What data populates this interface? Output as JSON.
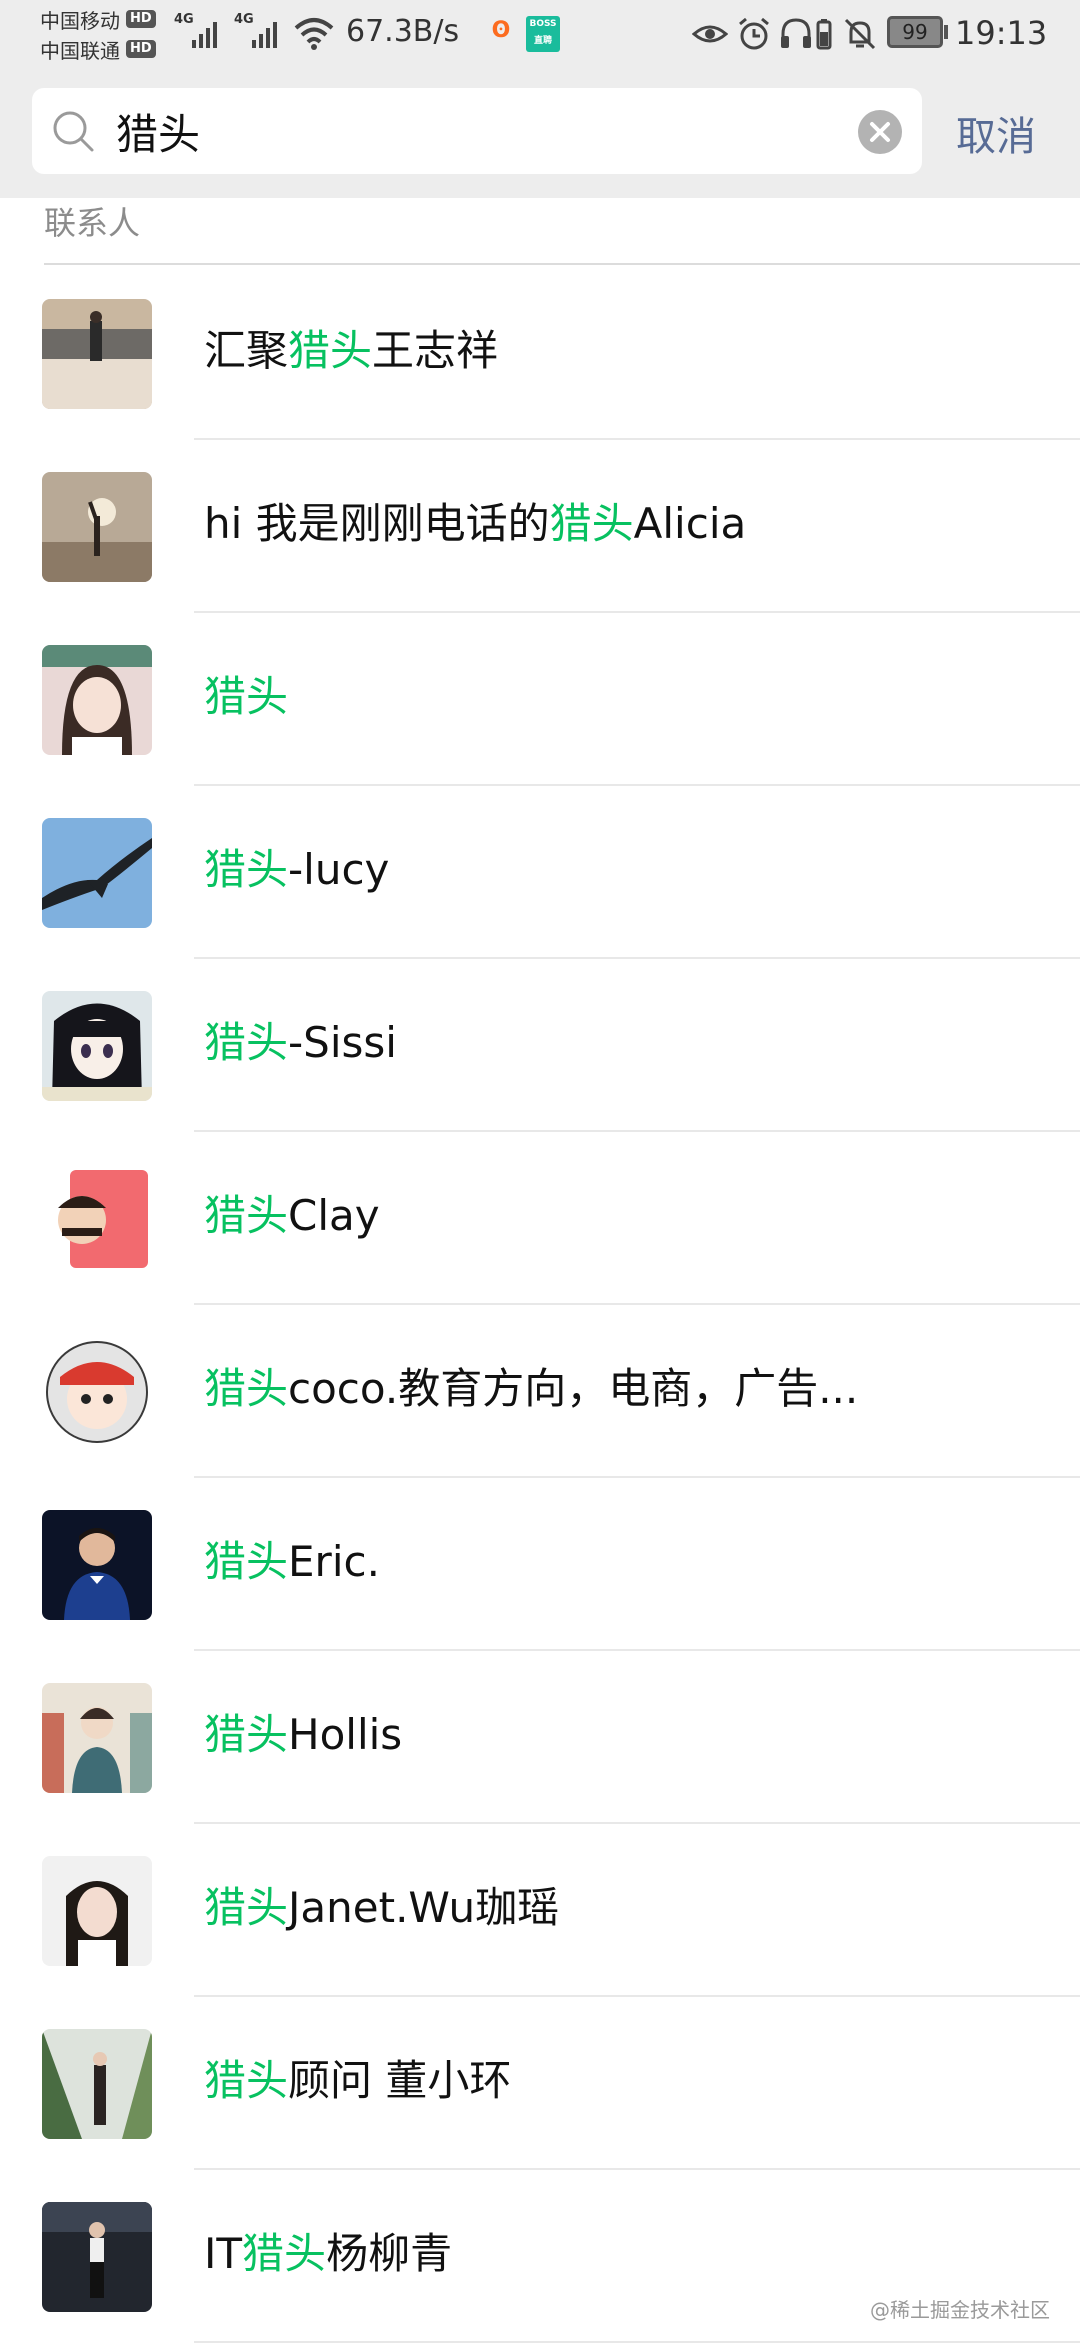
{
  "status_bar": {
    "carrier_1": "中国移动",
    "carrier_2": "中国联通",
    "hd_label": "HD",
    "network_type": "4G",
    "net_speed": "67.3B/s",
    "boss_label_top": "BOSS",
    "boss_label_bottom": "直聘",
    "battery_level": "99",
    "time": "19:13"
  },
  "search": {
    "query": "猎头",
    "cancel_label": "取消"
  },
  "section": {
    "title": "联系人"
  },
  "contacts": [
    {
      "pre": "汇聚",
      "hl": "猎头",
      "post": "王志祥"
    },
    {
      "pre": "hi 我是刚刚电话的",
      "hl": "猎头",
      "post": "Alicia"
    },
    {
      "pre": "",
      "hl": "猎头",
      "post": ""
    },
    {
      "pre": "",
      "hl": "猎头",
      "post": "-lucy"
    },
    {
      "pre": "",
      "hl": "猎头",
      "post": "-Sissi"
    },
    {
      "pre": "",
      "hl": "猎头",
      "post": "Clay"
    },
    {
      "pre": "",
      "hl": "猎头",
      "post": "coco.教育方向，电商，广告..."
    },
    {
      "pre": "",
      "hl": "猎头",
      "post": "Eric."
    },
    {
      "pre": "",
      "hl": "猎头",
      "post": "Hollis"
    },
    {
      "pre": "",
      "hl": "猎头",
      "post": "Janet.Wu珈瑶"
    },
    {
      "pre": "",
      "hl": "猎头",
      "post": "顾问 董小环"
    },
    {
      "pre": "IT",
      "hl": "猎头",
      "post": "杨柳青"
    }
  ],
  "watermark": "@稀土掘金技术社区",
  "colors": {
    "highlight": "#07c160",
    "cancel": "#576b95",
    "header_bg": "#ededed"
  }
}
